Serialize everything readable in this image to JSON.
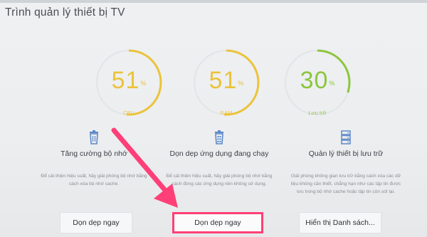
{
  "screen": {
    "title": "Trình quản lý thiết bị TV"
  },
  "gauges": [
    {
      "value": 51,
      "unit": "%",
      "label": "CPU",
      "fraction": 0.51,
      "color": "#ebc33a",
      "track": "#e2e4e7"
    },
    {
      "value": 51,
      "unit": "%",
      "label": "RAM",
      "fraction": 0.51,
      "color": "#ebc33a",
      "track": "#e2e4e7"
    },
    {
      "value": 30,
      "unit": "%",
      "label": "Lưu trữ",
      "fraction": 0.3,
      "color": "#8cc63e",
      "track": "#e2e4e7"
    }
  ],
  "sections": [
    {
      "icon": "trash-icon",
      "heading": "Tăng cường bộ nhớ",
      "description": "Để cải thiện hiệu suất, hãy giải phóng bộ nhớ bằng cách xóa bộ nhớ cache.",
      "button": "Dọn dẹp ngay"
    },
    {
      "icon": "app-cleanup-icon",
      "heading": "Dọn dẹp ứng dụng đang chạy",
      "description": "Để cải thiện hiệu suất, hãy giải phóng bộ nhớ bằng cách đóng các ứng dụng nền không sử dụng.",
      "button": "Dọn dẹp ngay"
    },
    {
      "icon": "storage-icon",
      "heading": "Quản lý thiết bị lưu trữ",
      "description": "Giải phóng không gian lưu trữ bằng cách xóa các dữ liệu không cần thiết, chẳng hạn như các tập tin được lưu trong bộ nhớ cache hoặc tập tin còn sót lại.",
      "button": "Hiển thị Danh sách..."
    }
  ],
  "colors": {
    "accent_highlight": "#ff3f77",
    "arrow": "#ff3f77",
    "icon_blue": "#5d88c7"
  }
}
